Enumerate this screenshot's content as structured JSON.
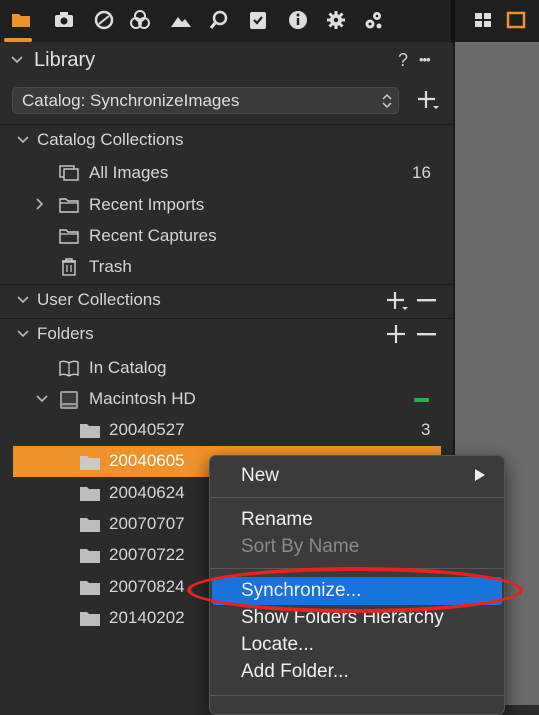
{
  "toolbar": {
    "icons": [
      "folder-icon",
      "camera-icon",
      "circle-icon",
      "color-circles-icon",
      "mountain-icon",
      "search-icon",
      "clipboard-check-icon",
      "info-icon",
      "gear-icon",
      "gears-icon"
    ],
    "right_icons": [
      "grid-icon",
      "single-view-icon"
    ],
    "accent": "#f0922b"
  },
  "library": {
    "title": "Library",
    "help": "?",
    "more": "•••",
    "catalog_select": "Catalog: SynchronizeImages",
    "add_symbol": "+"
  },
  "catalog_collections": {
    "title": "Catalog Collections",
    "items": [
      {
        "label": "All Images",
        "count": "16"
      },
      {
        "label": "Recent Imports"
      },
      {
        "label": "Recent Captures"
      },
      {
        "label": "Trash"
      }
    ]
  },
  "user_collections": {
    "title": "User Collections"
  },
  "folders": {
    "title": "Folders",
    "in_catalog": "In Catalog",
    "drive": "Macintosh HD",
    "items": [
      {
        "label": "20040527",
        "count": "3"
      },
      {
        "label": "20040605"
      },
      {
        "label": "20040624"
      },
      {
        "label": "20070707"
      },
      {
        "label": "20070722"
      },
      {
        "label": "20070824"
      },
      {
        "label": "20140202"
      }
    ]
  },
  "context_menu": {
    "new": "New",
    "rename": "Rename",
    "sort_by_name": "Sort By Name",
    "synchronize": "Synchronize...",
    "show_hierarchy": "Show Folders Hierarchy",
    "locate": "Locate...",
    "add_folder": "Add Folder...",
    "highlight_color": "#1a72dd",
    "annotation_color": "#e8231f"
  }
}
